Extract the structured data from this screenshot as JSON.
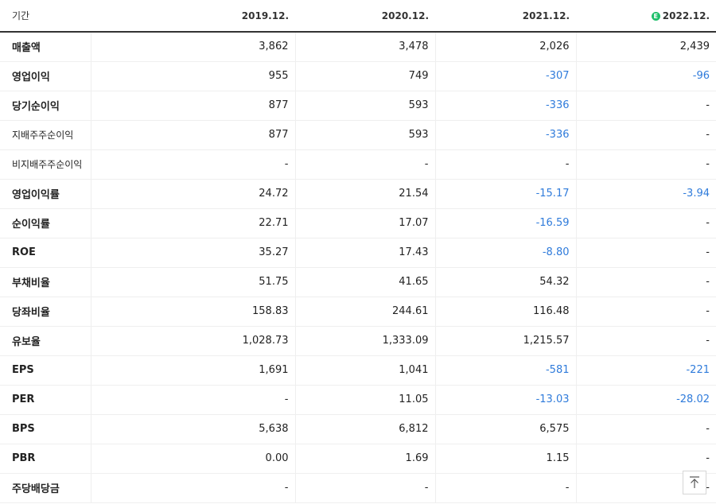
{
  "header": {
    "label": "기간",
    "periods": [
      "2019.12.",
      "2020.12.",
      "2021.12.",
      "2022.12."
    ],
    "estimate_badge": "E"
  },
  "colors": {
    "negative": "#2f7bdb",
    "estimate_badge": "#1fbf6a"
  },
  "rows": [
    {
      "label": "매출액",
      "values": [
        "3,862",
        "3,478",
        "2,026",
        "2,439"
      ]
    },
    {
      "label": "영업이익",
      "values": [
        "955",
        "749",
        "-307",
        "-96"
      ]
    },
    {
      "label": "당기순이익",
      "values": [
        "877",
        "593",
        "-336",
        "-"
      ]
    },
    {
      "label": "지배주주순이익",
      "values": [
        "877",
        "593",
        "-336",
        "-"
      ]
    },
    {
      "label": "비지배주주순이익",
      "values": [
        "-",
        "-",
        "-",
        "-"
      ]
    },
    {
      "label": "영업이익률",
      "values": [
        "24.72",
        "21.54",
        "-15.17",
        "-3.94"
      ]
    },
    {
      "label": "순이익률",
      "values": [
        "22.71",
        "17.07",
        "-16.59",
        "-"
      ]
    },
    {
      "label": "ROE",
      "values": [
        "35.27",
        "17.43",
        "-8.80",
        "-"
      ]
    },
    {
      "label": "부채비율",
      "values": [
        "51.75",
        "41.65",
        "54.32",
        "-"
      ]
    },
    {
      "label": "당좌비율",
      "values": [
        "158.83",
        "244.61",
        "116.48",
        "-"
      ]
    },
    {
      "label": "유보율",
      "values": [
        "1,028.73",
        "1,333.09",
        "1,215.57",
        "-"
      ]
    },
    {
      "label": "EPS",
      "values": [
        "1,691",
        "1,041",
        "-581",
        "-221"
      ]
    },
    {
      "label": "PER",
      "values": [
        "-",
        "11.05",
        "-13.03",
        "-28.02"
      ]
    },
    {
      "label": "BPS",
      "values": [
        "5,638",
        "6,812",
        "6,575",
        "-"
      ]
    },
    {
      "label": "PBR",
      "values": [
        "0.00",
        "1.69",
        "1.15",
        "-"
      ]
    },
    {
      "label": "주당배당금",
      "values": [
        "-",
        "-",
        "-",
        "-"
      ]
    }
  ],
  "scroll_top_icon": "arrow-up-to-line-icon"
}
